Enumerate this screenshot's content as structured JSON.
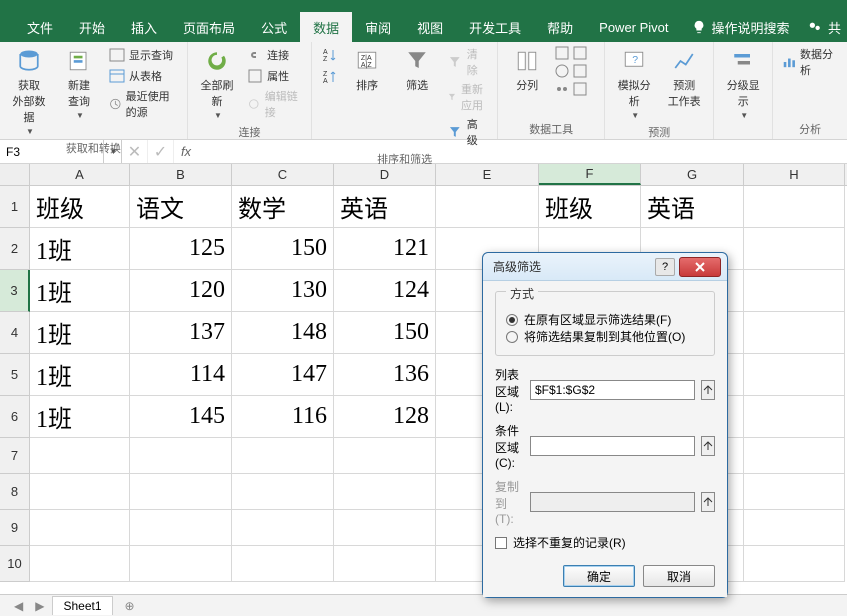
{
  "tabs": [
    "文件",
    "开始",
    "插入",
    "页面布局",
    "公式",
    "数据",
    "审阅",
    "视图",
    "开发工具",
    "帮助",
    "Power Pivot"
  ],
  "active_tab_index": 5,
  "tell_me": "操作说明搜索",
  "share_label": "共",
  "ribbon": {
    "groups": [
      {
        "label": "获取和转换",
        "items": [
          {
            "big": "获取\n外部数据"
          },
          {
            "big": "新建\n查询"
          },
          {
            "small": [
              "显示查询",
              "从表格",
              "最近使用的源"
            ]
          }
        ]
      },
      {
        "label": "连接",
        "items": [
          {
            "big": "全部刷新"
          },
          {
            "small": [
              "连接",
              "属性",
              "编辑链接"
            ]
          }
        ]
      },
      {
        "label": "排序和筛选",
        "items": [
          {
            "sort_buttons": true
          },
          {
            "big": "排序"
          },
          {
            "big": "筛选"
          },
          {
            "small": [
              "清除",
              "重新应用",
              "高级"
            ]
          }
        ]
      },
      {
        "label": "数据工具",
        "items": [
          {
            "big": "分列"
          }
        ]
      },
      {
        "label": "预测",
        "items": [
          {
            "big": "模拟分析"
          },
          {
            "big": "预测\n工作表"
          }
        ]
      },
      {
        "label": "",
        "items": [
          {
            "big": "分级显示"
          }
        ]
      },
      {
        "label": "分析",
        "items": [
          {
            "small": [
              "数据分析"
            ]
          }
        ]
      }
    ]
  },
  "name_box": "F3",
  "sheet": {
    "columns": [
      "A",
      "B",
      "C",
      "D",
      "E",
      "F",
      "G",
      "H"
    ],
    "data": [
      {
        "A": "班级",
        "B": "语文",
        "C": "数学",
        "D": "英语",
        "E": "",
        "F": "班级",
        "G": "英语",
        "H": ""
      },
      {
        "A": "1班",
        "B": "125",
        "C": "150",
        "D": "121",
        "E": "",
        "F": "",
        "G": "",
        "H": ""
      },
      {
        "A": "1班",
        "B": "120",
        "C": "130",
        "D": "124",
        "E": "",
        "F": "",
        "G": "",
        "H": ""
      },
      {
        "A": "1班",
        "B": "137",
        "C": "148",
        "D": "150",
        "E": "",
        "F": "",
        "G": "",
        "H": ""
      },
      {
        "A": "1班",
        "B": "114",
        "C": "147",
        "D": "136",
        "E": "",
        "F": "",
        "G": "",
        "H": ""
      },
      {
        "A": "1班",
        "B": "145",
        "C": "116",
        "D": "128",
        "E": "",
        "F": "",
        "G": "",
        "H": ""
      }
    ],
    "active_cell": "F3",
    "selected_row": 3,
    "selected_col": "F",
    "tab_name": "Sheet1"
  },
  "dialog": {
    "title": "高级筛选",
    "mode_group": "方式",
    "mode_opt1": "在原有区域显示筛选结果(F)",
    "mode_opt2": "将筛选结果复制到其他位置(O)",
    "list_range_label": "列表区域(L):",
    "list_range_value": "$F$1:$G$2",
    "criteria_label": "条件区域(C):",
    "criteria_value": "",
    "copy_to_label": "复制到(T):",
    "copy_to_value": "",
    "unique_label": "选择不重复的记录(R)",
    "ok": "确定",
    "cancel": "取消"
  }
}
